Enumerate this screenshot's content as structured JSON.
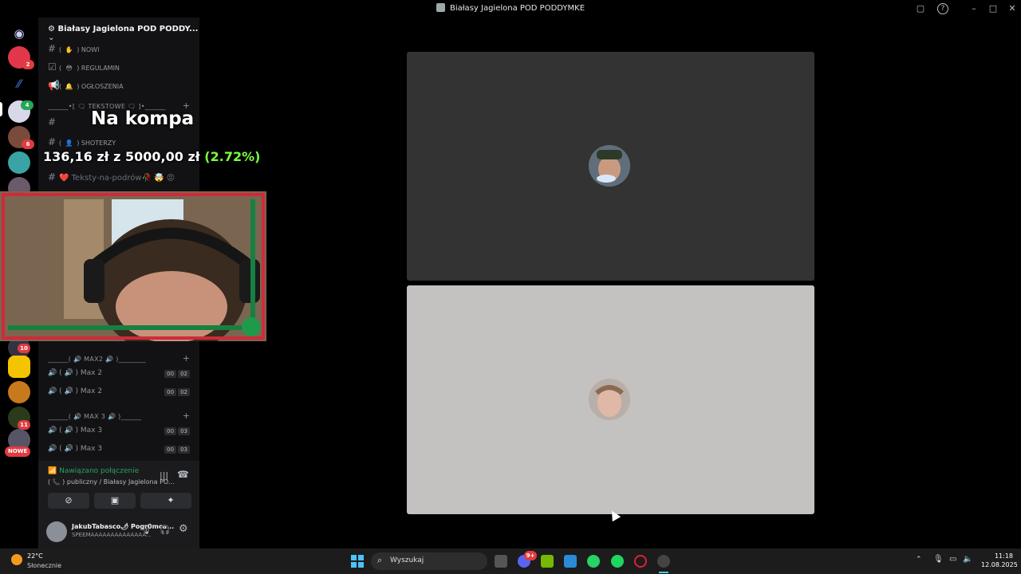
{
  "window": {
    "title": "Białasy Jagielona POD PODDYMKE"
  },
  "sidebar": {
    "server_name": "Białasy Jagielona POD PODDY...",
    "channels_top": [
      {
        "emoji": "✋",
        "label": "NOWI"
      },
      {
        "emoji": "😳",
        "label": "REGULAMIN"
      },
      {
        "emoji": "🔔",
        "label": "OGŁOSZENIA"
      }
    ],
    "category_text": "______•[ 🗨 TEKSTOWE 🗨 ]•______",
    "channel_shoterzy": "SHOTERZY",
    "channel_teksty": "❤️ Teksty-na-podrów🥀 🤯 😡",
    "category_max2": "______( 🔊 MAX2 🔊 )________",
    "max2_channels": [
      {
        "label": "Max 2",
        "n1": "00",
        "n2": "02"
      },
      {
        "label": "Max 2",
        "n1": "00",
        "n2": "02"
      }
    ],
    "category_max3": "______( 🔊 MAX 3 🔊 )______",
    "max3_channels": [
      {
        "label": "Max 3",
        "n1": "00",
        "n2": "03"
      },
      {
        "label": "Max 3",
        "n1": "00",
        "n2": "03"
      }
    ]
  },
  "rail": {
    "badges": {
      "b1": "2",
      "b2": "4",
      "b3": "6",
      "b4": "10",
      "b5": "11"
    },
    "new_label": "NOWE"
  },
  "overlay": {
    "title": "Na kompa",
    "money": "136,16 zł z 5000,00 zł",
    "percent": "(2.72%)"
  },
  "voice": {
    "status": "Nawiązano połączenie",
    "channel": "publiczny / Białasy Jagielona PO..."
  },
  "user": {
    "name": "JakubTabasco🌶 Pogr0mca...",
    "status": "SPEEMAAAAAAAAAAAAAA..."
  },
  "taskbar": {
    "weather_temp": "22°C",
    "weather_desc": "Słonecznie",
    "search_placeholder": "Wyszukaj",
    "time": "11:18",
    "date": "12.08.2025",
    "discord_badge": "9+"
  },
  "colors": {
    "tile_top": "#333333",
    "tile_bottom": "#c4c1c1",
    "voice_green": "#23a55a",
    "money_green": "#7cff3f"
  }
}
